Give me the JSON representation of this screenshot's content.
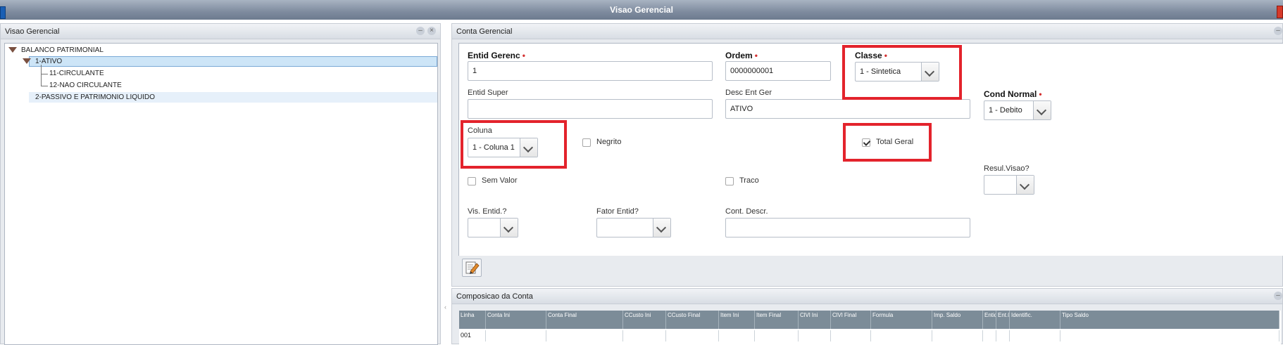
{
  "window": {
    "title": "Visao Gerencial"
  },
  "left_panel": {
    "title": "Visao Gerencial",
    "tree": [
      {
        "label": "BALANCO PATRIMONIAL",
        "expanded": true
      },
      {
        "label": "1-ATIVO",
        "expanded": true,
        "selected": true
      },
      {
        "label": "11-CIRCULANTE"
      },
      {
        "label": "12-NAO CIRCULANTE"
      },
      {
        "label": "2-PASSIVO E PATRIMONIO LIQUIDO"
      }
    ]
  },
  "right_panel": {
    "title": "Conta Gerencial",
    "fields": {
      "entid_gerenc": {
        "label": "Entid Gerenc",
        "value": "1"
      },
      "ordem": {
        "label": "Ordem",
        "value": "0000000001"
      },
      "classe": {
        "label": "Classe",
        "value": "1 - Sintetica"
      },
      "entid_super": {
        "label": "Entid Super",
        "value": ""
      },
      "desc_ent_ger": {
        "label": "Desc Ent Ger",
        "value": "ATIVO"
      },
      "cond_normal": {
        "label": "Cond Normal",
        "value": "1 - Debito"
      },
      "coluna": {
        "label": "Coluna",
        "value": "1 - Coluna 1"
      },
      "negrito": {
        "label": "Negrito",
        "checked": false
      },
      "total_geral": {
        "label": "Total Geral",
        "checked": true
      },
      "sem_valor": {
        "label": "Sem Valor",
        "checked": false
      },
      "traco": {
        "label": "Traco",
        "checked": false
      },
      "resul_visao": {
        "label": "Resul.Visao?",
        "value": ""
      },
      "vis_entid": {
        "label": "Vis. Entid.?",
        "value": ""
      },
      "fator_entid": {
        "label": "Fator Entid?",
        "value": ""
      },
      "cont_descr": {
        "label": "Cont. Descr.",
        "value": ""
      }
    },
    "edit_icon": "edit-icon"
  },
  "bottom_panel": {
    "title": "Composicao da Conta",
    "columns": [
      "Linha",
      "Conta Ini",
      "Conta Final",
      "CCusto Ini",
      "CCusto Final",
      "Item Ini",
      "Item Final",
      "ClVl Ini",
      "ClVl Final",
      "Formula",
      "Imp. Saldo",
      "Entid",
      "Ent.0",
      "Identific.",
      "Tipo Saldo"
    ],
    "rows": [
      [
        "001",
        "",
        "",
        "",
        "",
        "",
        "",
        "",
        "",
        "",
        "",
        "",
        "",
        "",
        ""
      ]
    ]
  },
  "colors": {
    "highlight": "#e3232c",
    "selection": "#cde5f7"
  }
}
